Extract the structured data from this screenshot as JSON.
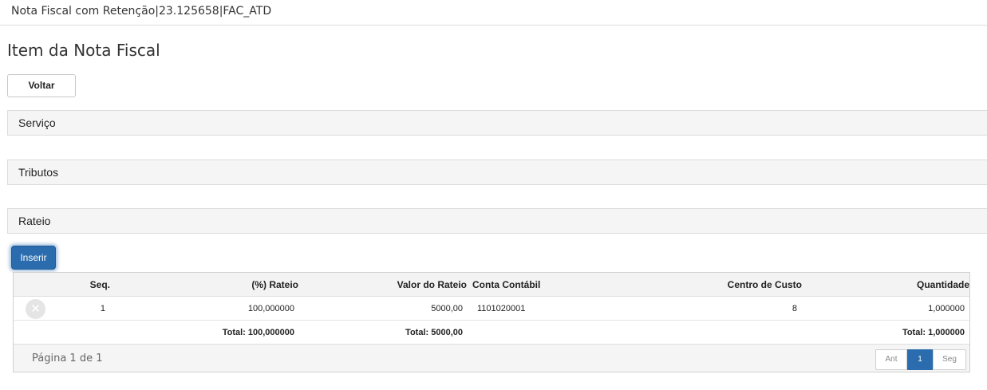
{
  "header": {
    "title": "Nota Fiscal com Retenção|23.125658|FAC_ATD"
  },
  "page": {
    "title": "Item da Nota Fiscal",
    "back_label": "Voltar"
  },
  "sections": {
    "servico": "Serviço",
    "tributos": "Tributos",
    "rateio": "Rateio"
  },
  "rateio": {
    "insert_label": "Inserir",
    "columns": {
      "seq": "Seq.",
      "pct": "(%) Rateio",
      "valor": "Valor do Rateio",
      "conta": "Conta Contábil",
      "centro": "Centro de Custo",
      "qtd": "Quantidade"
    },
    "rows": [
      {
        "delete_icon": "close-icon",
        "seq": "1",
        "pct": "100,000000",
        "valor": "5000,00",
        "conta": "1101020001",
        "centro": "8",
        "qtd": "1,000000"
      }
    ],
    "totals": {
      "pct": "Total: 100,000000",
      "valor": "Total: 5000,00",
      "qtd": "Total: 1,000000"
    },
    "pager": {
      "text": "Página 1 de 1",
      "prev": "Ant",
      "current": "1",
      "next": "Seg"
    }
  },
  "colors": {
    "accent": "#2a6cad",
    "section_bg": "#f5f5f5",
    "border": "#dcdcdc"
  }
}
